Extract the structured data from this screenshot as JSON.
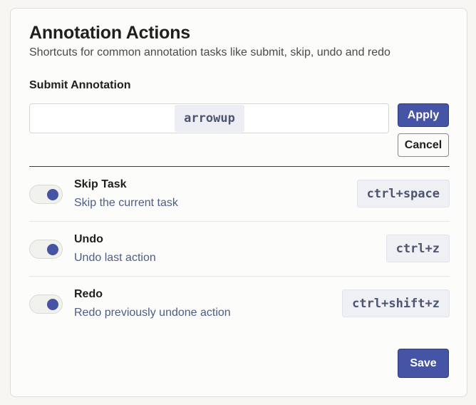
{
  "header": {
    "title": "Annotation Actions",
    "subtitle": "Shortcuts for common annotation tasks like submit, skip, undo and redo"
  },
  "submit": {
    "label": "Submit Annotation",
    "key": "arrowup",
    "apply_label": "Apply",
    "cancel_label": "Cancel"
  },
  "actions": [
    {
      "title": "Skip Task",
      "description": "Skip the current task",
      "shortcut": "ctrl+space",
      "enabled": true
    },
    {
      "title": "Undo",
      "description": "Undo last action",
      "shortcut": "ctrl+z",
      "enabled": true
    },
    {
      "title": "Redo",
      "description": "Redo previously undone action",
      "shortcut": "ctrl+shift+z",
      "enabled": true
    }
  ],
  "footer": {
    "save_label": "Save"
  },
  "colors": {
    "accent": "#4654a6",
    "description_text": "#4e5d86",
    "shortcut_bg": "#eef0f4"
  }
}
